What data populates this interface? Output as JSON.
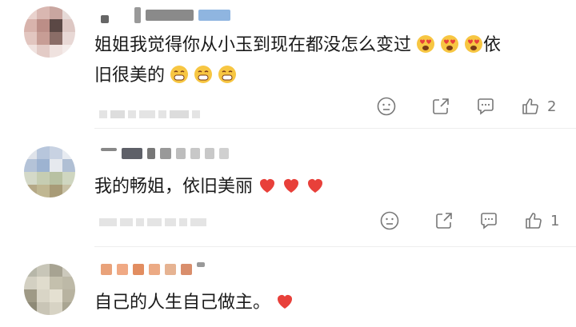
{
  "comments": [
    {
      "text_line1": "姐姐我觉得你从小玉到现在都没怎么变过",
      "text_line2": "依",
      "text_line3": "旧很美的",
      "likes": "2"
    },
    {
      "text_line1": "我的畅姐，依旧美丽",
      "likes": "1"
    },
    {
      "text_line1": "自己的人生自己做主。"
    }
  ],
  "icons": {
    "dislike": "dislike-face-icon",
    "share": "share-icon",
    "comment": "comment-icon",
    "like": "thumbs-up-icon"
  },
  "colors": {
    "heart": "#e8403a",
    "emoji_face": "#f7c642",
    "icon_gray": "#777777"
  }
}
